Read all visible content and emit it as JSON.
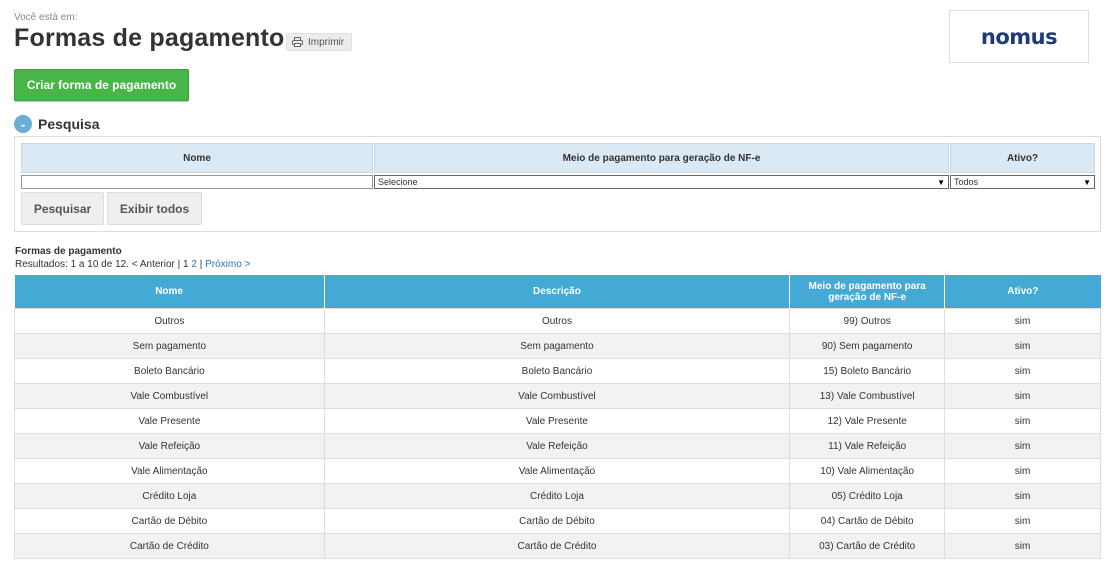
{
  "breadcrumb": "Você está em:",
  "page_title": "Formas de pagamento",
  "print_label": "Imprimir",
  "logo": "nomus",
  "create_button": "Criar forma de pagamento",
  "search": {
    "title": "Pesquisa",
    "collapse_symbol": "-",
    "col_name": "Nome",
    "col_meio": "Meio de pagamento para geração de NF-e",
    "col_ativo": "Ativo?",
    "name_value": "",
    "meio_selected": "Selecione",
    "ativo_selected": "Todos",
    "btn_search": "Pesquisar",
    "btn_show_all": "Exibir todos"
  },
  "results": {
    "title": "Formas de pagamento",
    "summary": "Resultados: 1 a 10 de 12.",
    "prev": "< Anterior",
    "sep1": "|",
    "page1": "1",
    "page2": "2",
    "sep2": "|",
    "next": "Próximo >"
  },
  "table": {
    "headers": [
      "Nome",
      "Descrição",
      "Meio de pagamento para geração de NF-e",
      "Ativo?"
    ],
    "rows": [
      [
        "Outros",
        "Outros",
        "99) Outros",
        "sim"
      ],
      [
        "Sem pagamento",
        "Sem pagamento",
        "90) Sem pagamento",
        "sim"
      ],
      [
        "Boleto Bancário",
        "Boleto Bancário",
        "15) Boleto Bancário",
        "sim"
      ],
      [
        "Vale Combustível",
        "Vale Combustível",
        "13) Vale Combustível",
        "sim"
      ],
      [
        "Vale Presente",
        "Vale Presente",
        "12) Vale Presente",
        "sim"
      ],
      [
        "Vale Refeição",
        "Vale Refeição",
        "11) Vale Refeição",
        "sim"
      ],
      [
        "Vale Alimentação",
        "Vale Alimentação",
        "10) Vale Alimentação",
        "sim"
      ],
      [
        "Crédito Loja",
        "Crédito Loja",
        "05) Crédito Loja",
        "sim"
      ],
      [
        "Cartão de Débito",
        "Cartão de Débito",
        "04) Cartão de Débito",
        "sim"
      ],
      [
        "Cartão de Crédito",
        "Cartão de Crédito",
        "03) Cartão de Crédito",
        "sim"
      ]
    ]
  },
  "colors": {
    "primary_green": "#48b548",
    "table_header": "#45a9d6",
    "filter_header": "#dbe9f4",
    "link": "#2a73c8"
  },
  "icons": [
    "printer-icon",
    "collapse-icon",
    "dropdown-arrow-icon"
  ]
}
